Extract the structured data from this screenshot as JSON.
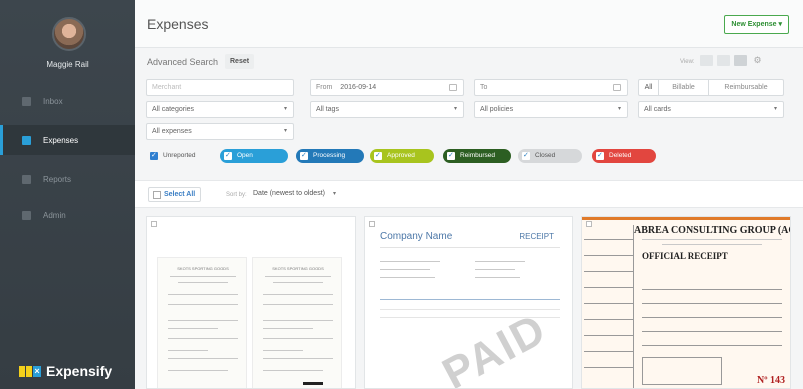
{
  "sidebar": {
    "user_name": "Maggie Rail",
    "items": [
      {
        "label": "Inbox",
        "icon": "inbox-icon",
        "active": false
      },
      {
        "label": "Expenses",
        "icon": "expenses-icon",
        "active": true
      },
      {
        "label": "Reports",
        "icon": "reports-icon",
        "active": false
      },
      {
        "label": "Admin",
        "icon": "admin-icon",
        "active": false
      }
    ],
    "brand": "Expensify"
  },
  "header": {
    "title": "Expenses",
    "new_expense_label": "New Expense ▾"
  },
  "search": {
    "title": "Advanced Search",
    "reset_label": "Reset",
    "view_label": "View:",
    "merchant_placeholder": "Merchant",
    "from_label": "From",
    "from_value": "2016-09-14",
    "to_label": "To",
    "to_value": "",
    "categories": "All categories",
    "tags": "All tags",
    "policies": "All policies",
    "cards": "All cards",
    "expenses": "All expenses",
    "billable_filter": [
      "All",
      "Billable",
      "Reimbursable"
    ]
  },
  "statuses": [
    {
      "label": "Unreported",
      "color": "#ffffff"
    },
    {
      "label": "Open",
      "color": "#2a9fd8"
    },
    {
      "label": "Processing",
      "color": "#2379b8"
    },
    {
      "label": "Approved",
      "color": "#a8c41e"
    },
    {
      "label": "Reimbursed",
      "color": "#2c5e22"
    },
    {
      "label": "Closed",
      "color": "#d6d8da"
    },
    {
      "label": "Deleted",
      "color": "#e2463f"
    }
  ],
  "list": {
    "select_all_label": "Select All",
    "sort_by_label": "Sort by:",
    "sort_value": "Date (newest to oldest)",
    "sort_caret": "▾"
  },
  "cards": {
    "receipt1": {
      "store": "SKOTS SPORTING GOODS"
    },
    "receipt2": {
      "company": "Company Name",
      "receipt_label": "RECEIPT",
      "stamp": "PAID"
    },
    "receipt3": {
      "title": "ABREA CONSULTING GROUP (ACG",
      "subtitle": "OFFICIAL RECEIPT",
      "number": "Nº 143"
    }
  }
}
